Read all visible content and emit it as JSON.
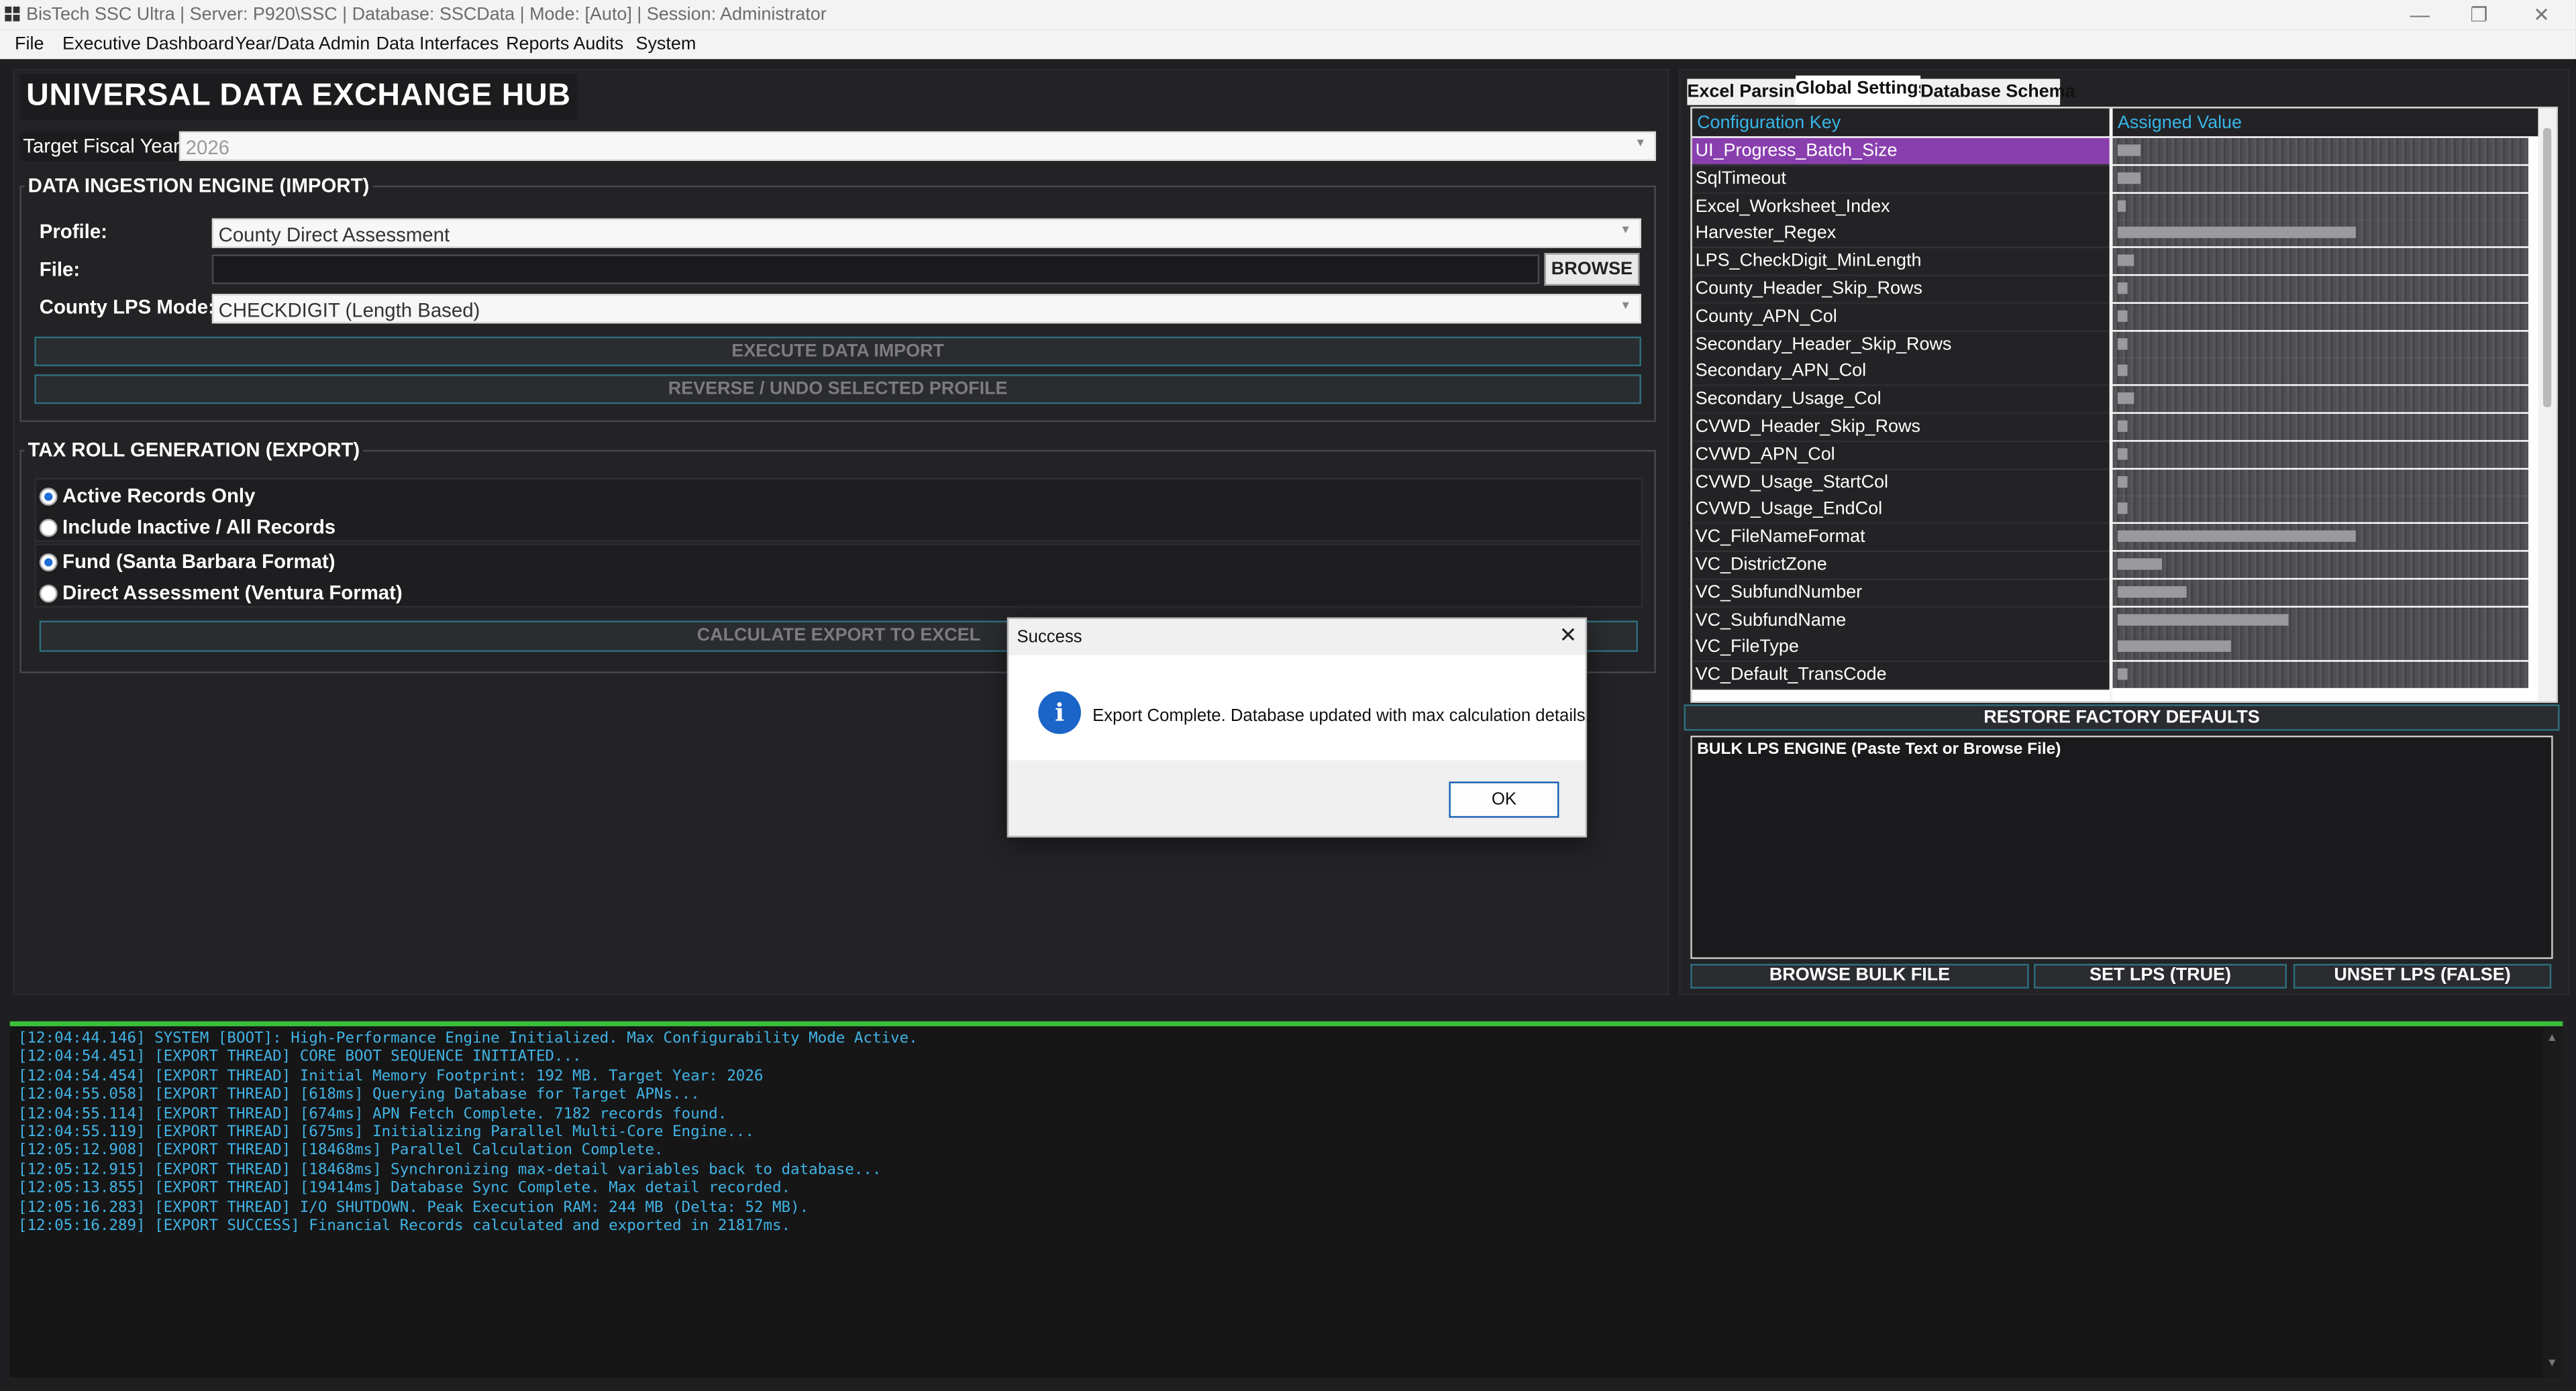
{
  "window": {
    "title": "BisTech SSC Ultra | Server: P920\\SSC | Database: SSCData | Mode: [Auto] | Session: Administrator",
    "minimize_glyph": "—",
    "maximize_glyph": "❐",
    "close_glyph": "✕"
  },
  "menu": [
    "File",
    "Executive Dashboard",
    "Year/Data Admin",
    "Data Interfaces",
    "Reports  Audits",
    "System"
  ],
  "hub": {
    "title": "UNIVERSAL DATA EXCHANGE HUB",
    "fiscal_year_label": "Target Fiscal Year:",
    "fiscal_year_value": "2026"
  },
  "import": {
    "group_title": "DATA INGESTION ENGINE (IMPORT)",
    "profile_label": "Profile:",
    "profile_value": "County Direct Assessment",
    "file_label": "File:",
    "file_value": "",
    "browse_label": "BROWSE",
    "lps_label": "County LPS Mode:",
    "lps_value": "CHECKDIGIT (Length Based)",
    "execute_label": "EXECUTE DATA IMPORT",
    "reverse_label": "REVERSE / UNDO SELECTED PROFILE"
  },
  "export": {
    "group_title": "TAX ROLL GENERATION (EXPORT)",
    "record_options": [
      {
        "label": "Active Records Only",
        "selected": true
      },
      {
        "label": "Include Inactive / All Records",
        "selected": false
      }
    ],
    "format_options": [
      {
        "label": "Fund (Santa Barbara Format)",
        "selected": true
      },
      {
        "label": "Direct Assessment (Ventura Format)",
        "selected": false
      }
    ],
    "calculate_label": "CALCULATE  EXPORT TO EXCEL"
  },
  "tabs": [
    {
      "label": "Excel Parsing",
      "active": false
    },
    {
      "label": "Global Settings",
      "active": true
    },
    {
      "label": "Database Schema",
      "active": false
    }
  ],
  "config_grid": {
    "col_key": "Configuration Key",
    "col_value": "Assigned Value",
    "selected_key": "UI_Progress_Batch_Size",
    "rows": [
      "UI_Progress_Batch_Size",
      "SqlTimeout",
      "Excel_Worksheet_Index",
      "Harvester_Regex",
      "LPS_CheckDigit_MinLength",
      "County_Header_Skip_Rows",
      "County_APN_Col",
      "Secondary_Header_Skip_Rows",
      "Secondary_APN_Col",
      "Secondary_Usage_Col",
      "CVWD_Header_Skip_Rows",
      "CVWD_APN_Col",
      "CVWD_Usage_StartCol",
      "CVWD_Usage_EndCol",
      "VC_FileNameFormat",
      "VC_DistrictZone",
      "VC_SubfundNumber",
      "VC_SubfundName",
      "VC_FileType",
      "VC_Default_TransCode"
    ]
  },
  "restore_label": "RESTORE FACTORY DEFAULTS",
  "bulk": {
    "title": "BULK LPS ENGINE (Paste Text or Browse File)",
    "browse_label": "BROWSE BULK FILE",
    "set_label": "SET LPS (TRUE)",
    "unset_label": "UNSET LPS (FALSE)"
  },
  "console_lines": [
    "[12:04:44.146] SYSTEM [BOOT]: High-Performance Engine Initialized. Max Configurability Mode Active.",
    "[12:04:54.451] [EXPORT THREAD] CORE BOOT SEQUENCE INITIATED...",
    "[12:04:54.454] [EXPORT THREAD] Initial Memory Footprint: 192 MB. Target Year: 2026",
    "[12:04:55.058] [EXPORT THREAD] [618ms] Querying Database for Target APNs...",
    "[12:04:55.114] [EXPORT THREAD] [674ms] APN Fetch Complete. 7182 records found.",
    "[12:04:55.119] [EXPORT THREAD] [675ms] Initializing Parallel Multi-Core Engine...",
    "[12:05:12.908] [EXPORT THREAD] [18468ms] Parallel Calculation Complete.",
    "[12:05:12.915] [EXPORT THREAD] [18468ms] Synchronizing max-detail variables back to database...",
    "[12:05:13.855] [EXPORT THREAD] [19414ms] Database Sync Complete. Max detail recorded.",
    "[12:05:16.283] [EXPORT THREAD] I/O SHUTDOWN. Peak Execution RAM: 244 MB (Delta: 52 MB).",
    "[12:05:16.289] [EXPORT SUCCESS] Financial Records calculated and exported in 21817ms."
  ],
  "dialog": {
    "title": "Success",
    "message": "Export Complete. Database updated with max calculation details.",
    "ok_label": "OK",
    "icon": "info-icon"
  },
  "colors": {
    "accent_selected_row": "#8a3fae",
    "console_text": "#41b3e4",
    "console_border": "#3bbf3b",
    "header_text": "#38b6e8"
  }
}
